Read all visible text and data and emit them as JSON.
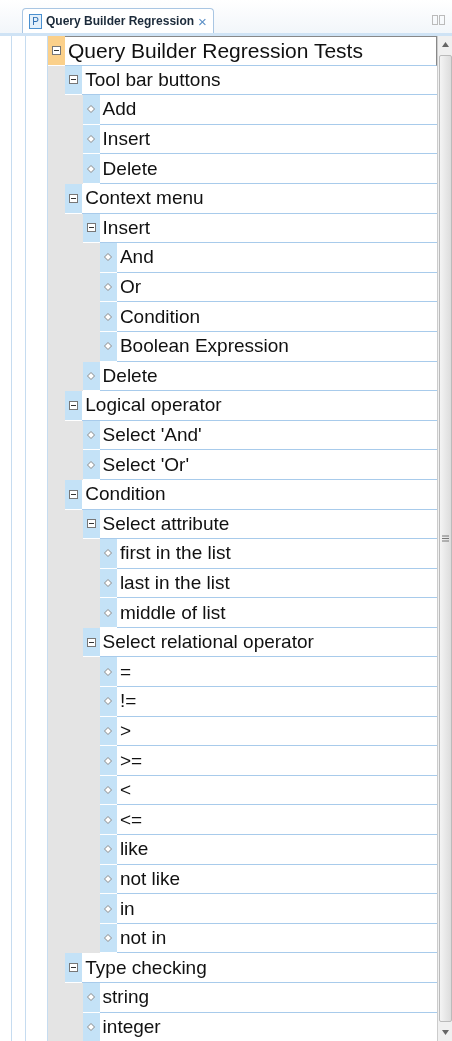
{
  "tab": {
    "icon_letter": "P",
    "title": "Query Builder Regression",
    "close": "×",
    "selected": true
  },
  "tree": [
    {
      "label": "Query Builder Regression Tests",
      "expanded": true,
      "selected": true,
      "children": [
        {
          "label": "Tool bar buttons",
          "expanded": true,
          "selected": false,
          "children": [
            {
              "label": "Add",
              "selected": false
            },
            {
              "label": "Insert",
              "selected": false
            },
            {
              "label": "Delete",
              "selected": false
            }
          ]
        },
        {
          "label": "Context menu",
          "expanded": true,
          "selected": false,
          "children": [
            {
              "label": "Insert",
              "expanded": true,
              "selected": false,
              "children": [
                {
                  "label": "And",
                  "selected": false
                },
                {
                  "label": "Or",
                  "selected": false
                },
                {
                  "label": "Condition",
                  "selected": false
                },
                {
                  "label": "Boolean Expression",
                  "selected": false
                }
              ]
            },
            {
              "label": "Delete",
              "selected": false
            }
          ]
        },
        {
          "label": "Logical operator",
          "expanded": true,
          "selected": false,
          "children": [
            {
              "label": "Select 'And'",
              "selected": false
            },
            {
              "label": "Select 'Or'",
              "selected": false
            }
          ]
        },
        {
          "label": "Condition",
          "expanded": true,
          "selected": false,
          "children": [
            {
              "label": "Select attribute",
              "expanded": true,
              "selected": false,
              "children": [
                {
                  "label": "first in the list",
                  "selected": false
                },
                {
                  "label": "last in the list",
                  "selected": false
                },
                {
                  "label": "middle of list",
                  "selected": false
                }
              ]
            },
            {
              "label": "Select relational operator",
              "expanded": true,
              "selected": false,
              "children": [
                {
                  "label": "=",
                  "selected": false
                },
                {
                  "label": "!=",
                  "selected": false
                },
                {
                  "label": ">",
                  "selected": false
                },
                {
                  "label": ">=",
                  "selected": false
                },
                {
                  "label": "<",
                  "selected": false
                },
                {
                  "label": "<=",
                  "selected": false
                },
                {
                  "label": "like",
                  "selected": false
                },
                {
                  "label": "not like",
                  "selected": false
                },
                {
                  "label": "in",
                  "selected": false
                },
                {
                  "label": "not in",
                  "selected": false
                }
              ]
            }
          ]
        },
        {
          "label": "Type checking",
          "expanded": true,
          "selected": false,
          "children": [
            {
              "label": "string",
              "selected": false
            },
            {
              "label": "integer",
              "selected": false
            }
          ]
        }
      ]
    }
  ]
}
